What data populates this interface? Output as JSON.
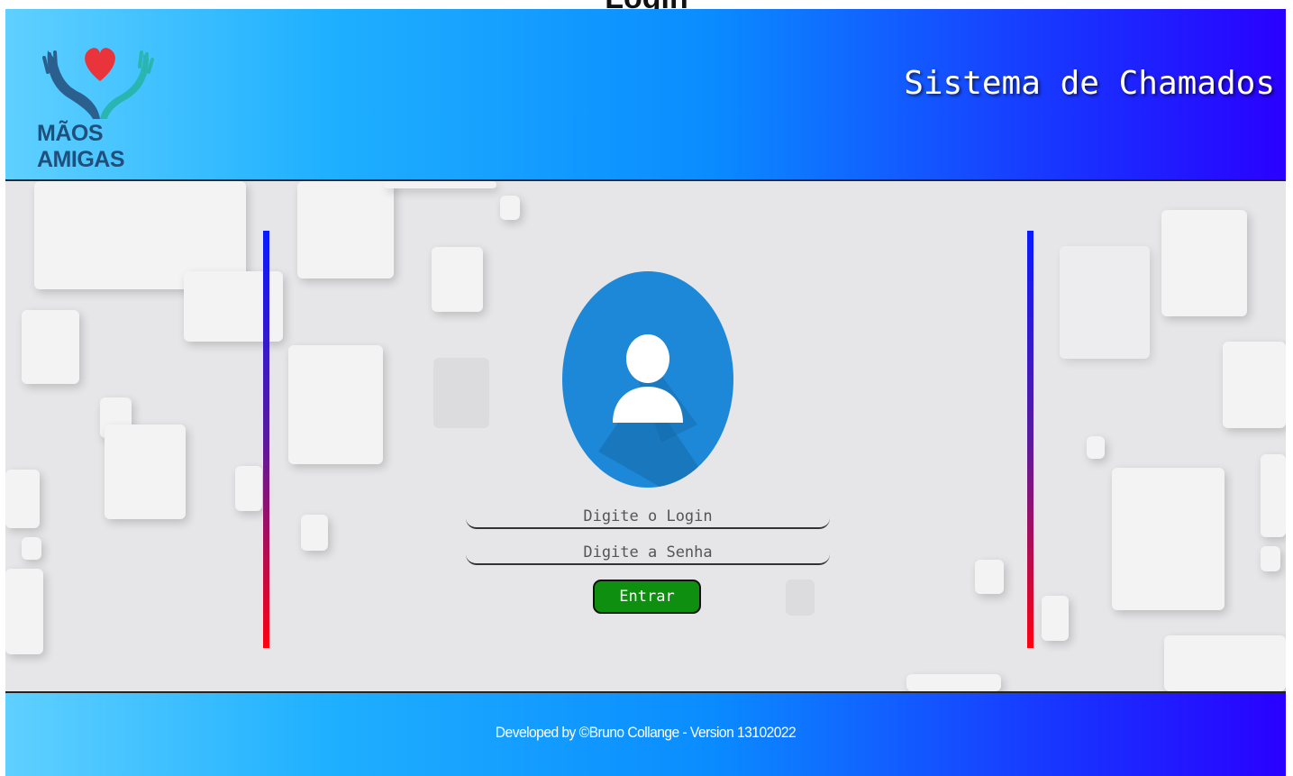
{
  "header": {
    "logo_text": "MÃOS AMIGAS",
    "title": "Sistema de Chamados"
  },
  "page": {
    "clipped_heading": "Login"
  },
  "login_form": {
    "login_placeholder": "Digite o Login",
    "password_placeholder": "Digite a Senha",
    "submit_label": "Entrar"
  },
  "footer": {
    "text": "Developed by ©Bruno Collange - Version 13102022"
  },
  "colors": {
    "header_gradient_start": "#5fd0ff",
    "header_gradient_end": "#2a00ff",
    "avatar_bg": "#1e88d8",
    "button_bg": "#0f8f0f",
    "line_top": "#0a1aff",
    "line_bottom": "#ff0010"
  },
  "icons": {
    "logo": "heart-hands-icon",
    "avatar": "user-icon"
  }
}
